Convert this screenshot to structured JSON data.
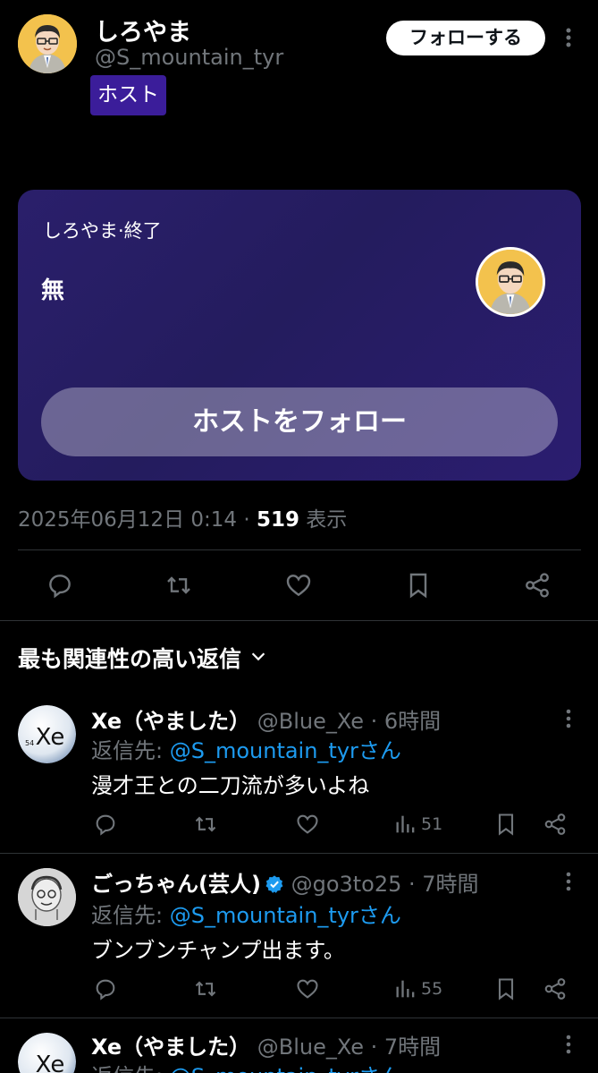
{
  "tweet": {
    "author_name": "しろやま",
    "author_handle": "@S_mountain_tyr",
    "host_badge": "ホスト",
    "follow_label": "フォローする"
  },
  "space": {
    "meta": "しろやま·終了",
    "title": "無",
    "follow_host_label": "ホストをフォロー"
  },
  "stats": {
    "datetime": "2025年06月12日 0:14",
    "separator": " · ",
    "views_count": "519",
    "views_label": " 表示"
  },
  "actions": [
    "reply-icon",
    "retweet-icon",
    "like-icon",
    "bookmark-icon",
    "share-icon"
  ],
  "replies_sort_label": "最も関連性の高い返信",
  "replies": [
    {
      "name": "Xe（やました）",
      "handle": "@Blue_Xe · 6時間",
      "reply_prefix": "返信先: ",
      "reply_to": "@S_mountain_tyrさん",
      "text": "漫才王との二刀流が多いよね",
      "views": "51",
      "verified": false
    },
    {
      "name": "ごっちゃん(芸人)",
      "handle": "@go3to25 · 7時間",
      "reply_prefix": "返信先: ",
      "reply_to": "@S_mountain_tyrさん",
      "text": "ブンブンチャンプ出ます。",
      "views": "55",
      "verified": true
    },
    {
      "name": "Xe（やました）",
      "handle": "@Blue_Xe · 7時間",
      "reply_prefix": "返信先: ",
      "reply_to": "@S_mountain_tyrさん",
      "text": "",
      "views": "",
      "verified": false
    }
  ],
  "colors": {
    "accent": "#1d9bf0",
    "host_badge_bg": "#3b1d9a",
    "space_card_bg": "#241c5e",
    "muted": "#71767b"
  }
}
